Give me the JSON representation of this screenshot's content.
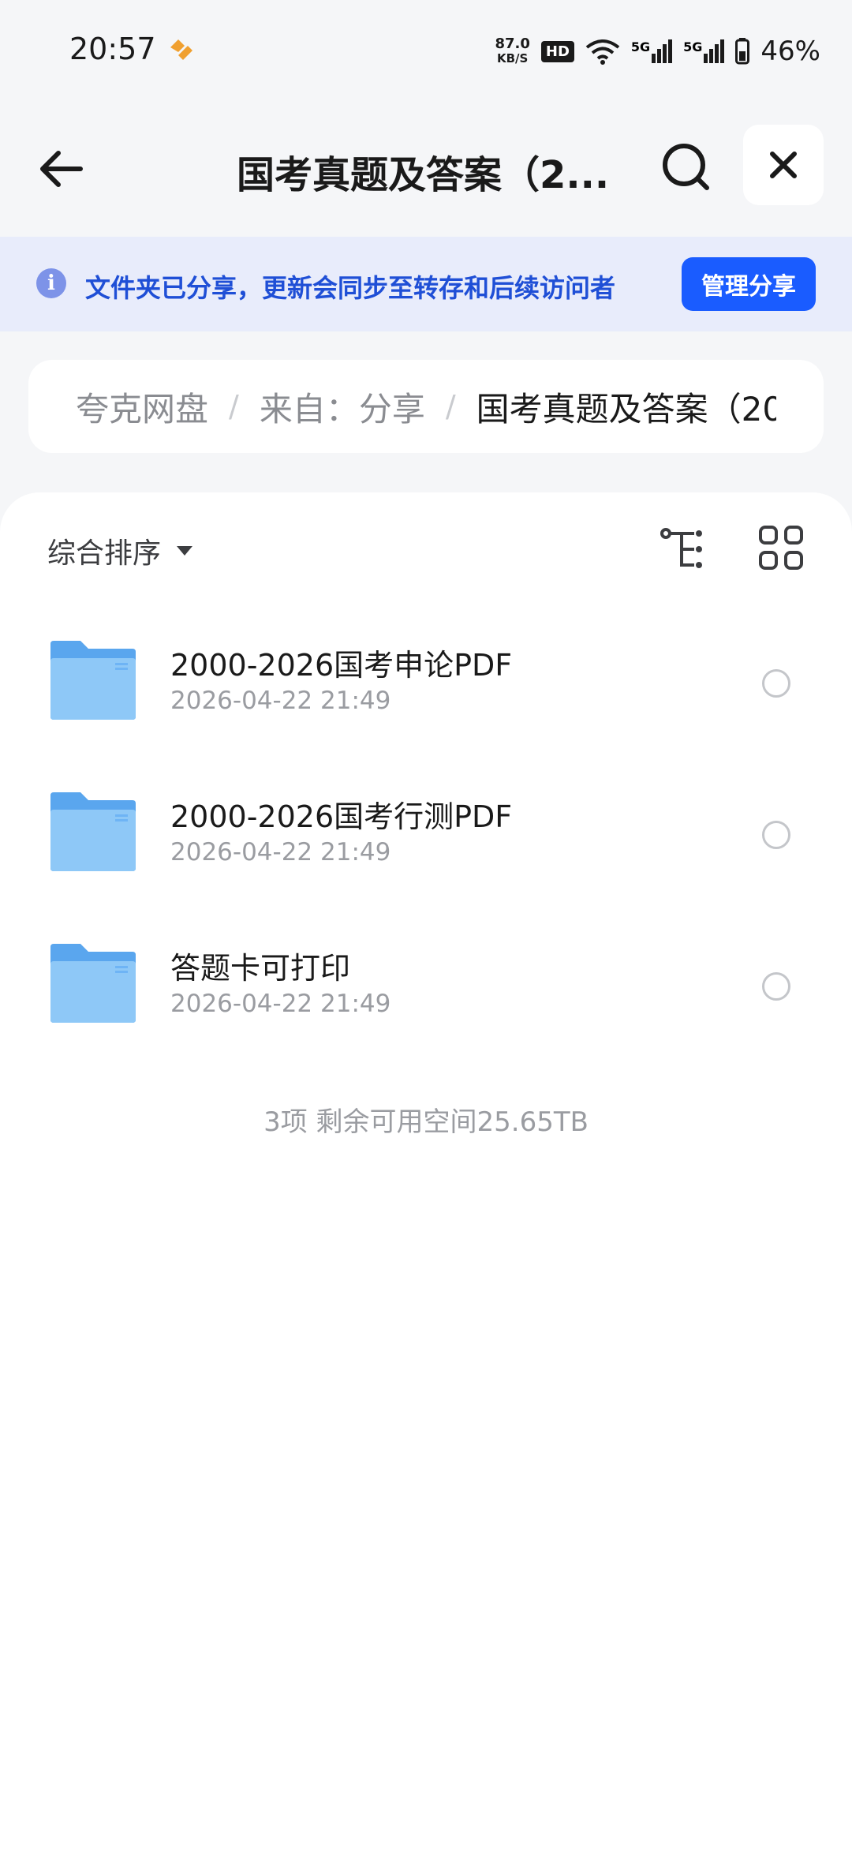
{
  "status_bar": {
    "time": "20:57",
    "net_speed_value": "87.0",
    "net_speed_unit": "KB/S",
    "hd_label": "HD",
    "signal_1": "5G",
    "signal_2": "5G",
    "battery": "46%",
    "icons": [
      "app-notification-icon",
      "wifi-icon",
      "signal-icon",
      "battery-icon"
    ]
  },
  "header": {
    "title": "国考真题及答案（2...",
    "icons": [
      "back-arrow-icon",
      "search-icon",
      "close-icon"
    ]
  },
  "banner": {
    "text": "文件夹已分享，更新会同步至转存和后续访问者",
    "button": "管理分享",
    "icon": "info-icon"
  },
  "breadcrumb": {
    "items": [
      "夸克网盘",
      "来自：分享",
      "国考真题及答案（20"
    ],
    "separator": "/"
  },
  "toolbar": {
    "sort_label": "综合排序",
    "icons": [
      "sort-caret-icon",
      "tree-view-icon",
      "grid-view-icon"
    ]
  },
  "files": [
    {
      "name": "2000-2026国考申论PDF",
      "date": "2026-04-22 21:49"
    },
    {
      "name": "2000-2026国考行测PDF",
      "date": "2026-04-22 21:49"
    },
    {
      "name": "答题卡可打印",
      "date": "2026-04-22 21:49"
    }
  ],
  "footer": {
    "text": "3项 剩余可用空间25.65TB"
  },
  "colors": {
    "accent": "#1a5cff",
    "banner_bg": "#e8ecfb",
    "banner_text": "#1f4fd6",
    "folder": "#6eb4f5"
  }
}
